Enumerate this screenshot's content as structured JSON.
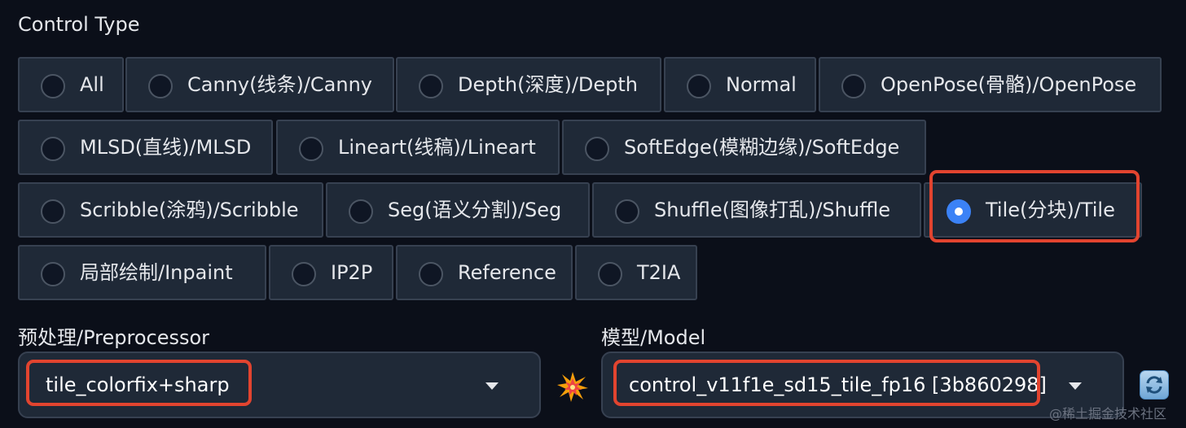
{
  "control_type": {
    "label": "Control Type",
    "selected": "Tile(分块)/Tile",
    "options": [
      {
        "label": "All"
      },
      {
        "label": "Canny(线条)/Canny"
      },
      {
        "label": "Depth(深度)/Depth"
      },
      {
        "label": "Normal"
      },
      {
        "label": "OpenPose(骨骼)/OpenPose"
      },
      {
        "label": "MLSD(直线)/MLSD"
      },
      {
        "label": "Lineart(线稿)/Lineart"
      },
      {
        "label": "SoftEdge(模糊边缘)/SoftEdge"
      },
      {
        "label": "Scribble(涂鸦)/Scribble"
      },
      {
        "label": "Seg(语义分割)/Seg"
      },
      {
        "label": "Shuffle(图像打乱)/Shuffle"
      },
      {
        "label": "Tile(分块)/Tile"
      },
      {
        "label": "局部绘制/Inpaint"
      },
      {
        "label": "IP2P"
      },
      {
        "label": "Reference"
      },
      {
        "label": "T2IA"
      }
    ]
  },
  "preprocessor": {
    "label": "预处理/Preprocessor",
    "value": "tile_colorfix+sharp"
  },
  "model": {
    "label": "模型/Model",
    "value": "control_v11f1e_sd15_tile_fp16 [3b860298]"
  },
  "icons": {
    "run_preprocessor": "collision-spark-icon",
    "refresh": "refresh-icon"
  },
  "colors": {
    "background": "#0b0f19",
    "radio_selected": "#3b82f6",
    "highlight": "#e2442f"
  },
  "watermark": "@稀土掘金技术社区"
}
